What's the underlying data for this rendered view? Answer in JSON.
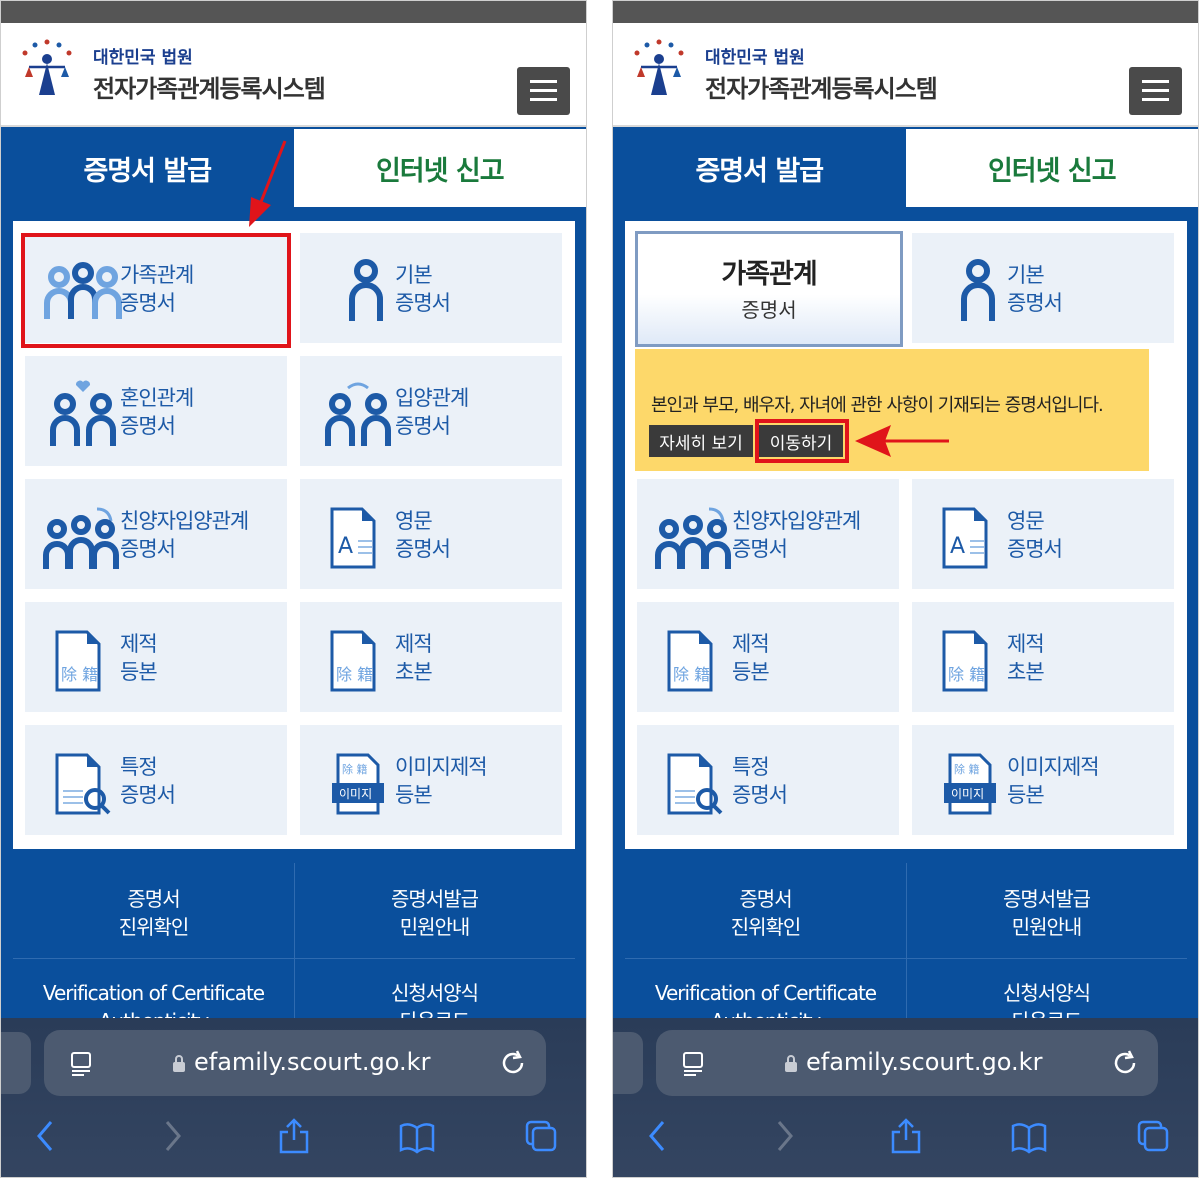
{
  "header": {
    "court_name": "대한민국 법원",
    "system_name": "전자가족관계등록시스템"
  },
  "tabs": {
    "active": "증명서 발급",
    "inactive": "인터넷 신고"
  },
  "cards": {
    "family": "가족관계\n증명서",
    "basic": "기본\n증명서",
    "marriage": "혼인관계\n증명서",
    "adoption": "입양관계\n증명서",
    "special_adoption": "친양자입양관계\n증명서",
    "english": "영문\n증명서",
    "removed_full": "제적\n등본",
    "removed_abstract": "제적\n초본",
    "specific": "특정\n증명서",
    "image_removed": "이미지제적\n등본"
  },
  "selected_card": {
    "title": "가족관계",
    "subtitle": "증명서"
  },
  "callout": {
    "text": "본인과 부모, 배우자, 자녀에 관한 사항이 기재되는 증명서입니다.",
    "detail_button": "자세히 보기",
    "go_button": "이동하기"
  },
  "icon_text": {
    "jejeok": "除 籍",
    "image": "이미지",
    "english_letter": "A"
  },
  "bottom_links": {
    "verify": "증명서\n진위확인",
    "guide": "증명서발급\n민원안내",
    "verify_en": "Verification of Certificate\nAuthenticity",
    "forms": "신청서양식\n다운로드"
  },
  "browser": {
    "url": "efamily.scourt.go.kr"
  },
  "colors": {
    "brand_blue": "#0a4f9c",
    "card_bg": "#ebf1f8",
    "callout_yellow": "#fdd86a",
    "highlight_red": "#e0141a",
    "tab_green": "#1a7a3c"
  }
}
